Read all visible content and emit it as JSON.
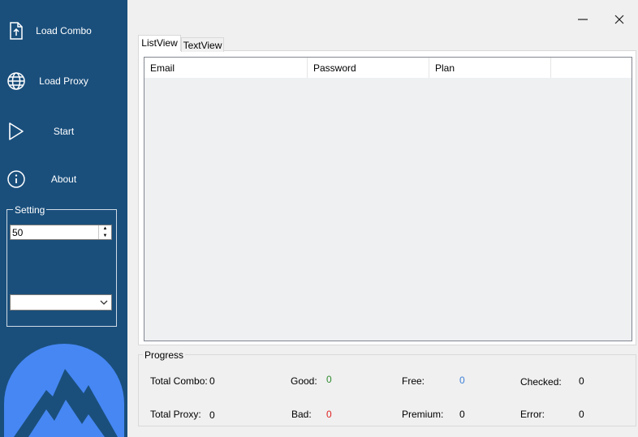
{
  "sidebar": {
    "items": [
      {
        "label": "Load Combo",
        "icon": "file-upload-icon"
      },
      {
        "label": "Load Proxy",
        "icon": "globe-icon"
      },
      {
        "label": "Start",
        "icon": "play-icon"
      },
      {
        "label": "About",
        "icon": "info-icon"
      }
    ],
    "setting": {
      "legend": "Setting",
      "threads_value": "50",
      "dropdown_value": ""
    }
  },
  "tabs": [
    {
      "label": "ListView",
      "selected": true
    },
    {
      "label": "TextView",
      "selected": false
    }
  ],
  "listview": {
    "columns": [
      "Email",
      "Password",
      "Plan",
      ""
    ]
  },
  "progress": {
    "legend": "Progress",
    "total_combo": {
      "label": "Total Combo:",
      "value": "0"
    },
    "total_proxy": {
      "label": "Total Proxy:",
      "value": "0"
    },
    "good": {
      "label": "Good:",
      "value": "0",
      "color": "#2e8b2e"
    },
    "bad": {
      "label": "Bad:",
      "value": "0",
      "color": "#e02020"
    },
    "free": {
      "label": "Free:",
      "value": "0",
      "color": "#3c7fd8"
    },
    "premium": {
      "label": "Premium:",
      "value": "0"
    },
    "checked": {
      "label": "Checked:",
      "value": "0"
    },
    "error": {
      "label": "Error:",
      "value": "0"
    }
  },
  "colors": {
    "sidebar_bg": "#1a4f7c",
    "logo_blue": "#4687f4"
  }
}
